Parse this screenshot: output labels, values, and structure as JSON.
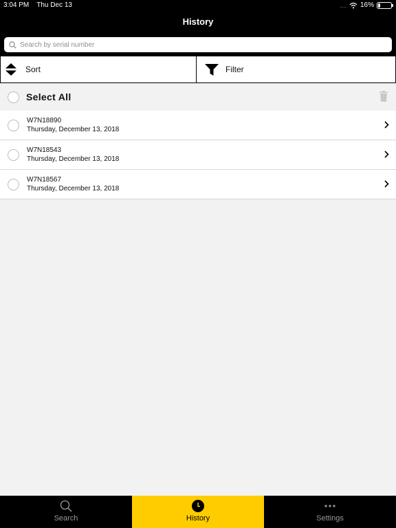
{
  "status_bar": {
    "time": "3:04 PM",
    "date": "Thu Dec 13",
    "signal": "....",
    "battery_percent": "16%",
    "battery_level": 0.16
  },
  "nav": {
    "title": "History"
  },
  "search": {
    "placeholder": "Search by serial number",
    "value": ""
  },
  "toolbar": {
    "sort_label": "Sort",
    "filter_label": "Filter"
  },
  "select_all": {
    "label": "Select All"
  },
  "history": [
    {
      "serial": "W7N18890",
      "date": "Thursday, December 13, 2018"
    },
    {
      "serial": "W7N18543",
      "date": "Thursday, December 13, 2018"
    },
    {
      "serial": "W7N18567",
      "date": "Thursday, December 13, 2018"
    }
  ],
  "tabs": [
    {
      "label": "Search",
      "icon": "search-icon",
      "active": false
    },
    {
      "label": "History",
      "icon": "clock-icon",
      "active": true
    },
    {
      "label": "Settings",
      "icon": "more-dots-icon",
      "active": false
    }
  ],
  "colors": {
    "accent": "#ffcc00",
    "bar": "#000000",
    "background": "#f2f2f2"
  }
}
